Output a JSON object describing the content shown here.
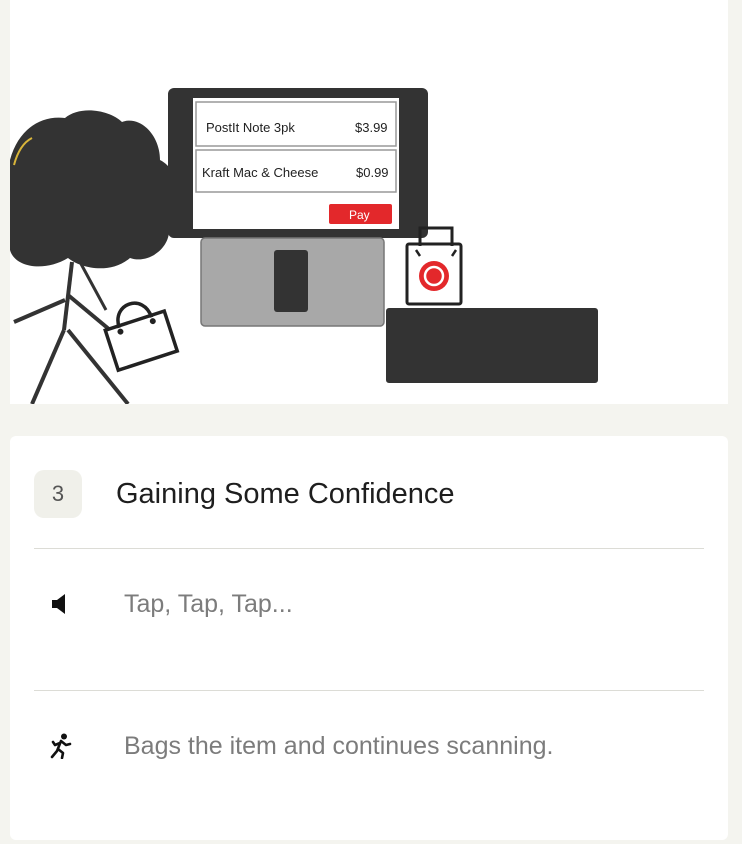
{
  "illustration": {
    "receipt_items": [
      {
        "name": "PostIt Note 3pk",
        "price": "$3.99"
      },
      {
        "name": "Kraft Mac & Cheese",
        "price": "$0.99"
      }
    ],
    "pay_label": "Pay",
    "pay_color": "#e3282b"
  },
  "step": {
    "number": "3",
    "title": "Gaining Some Confidence",
    "rows": [
      {
        "icon": "speaker-icon",
        "text": "Tap, Tap, Tap..."
      },
      {
        "icon": "running-person-icon",
        "text": "Bags the item and continues scanning."
      }
    ]
  }
}
